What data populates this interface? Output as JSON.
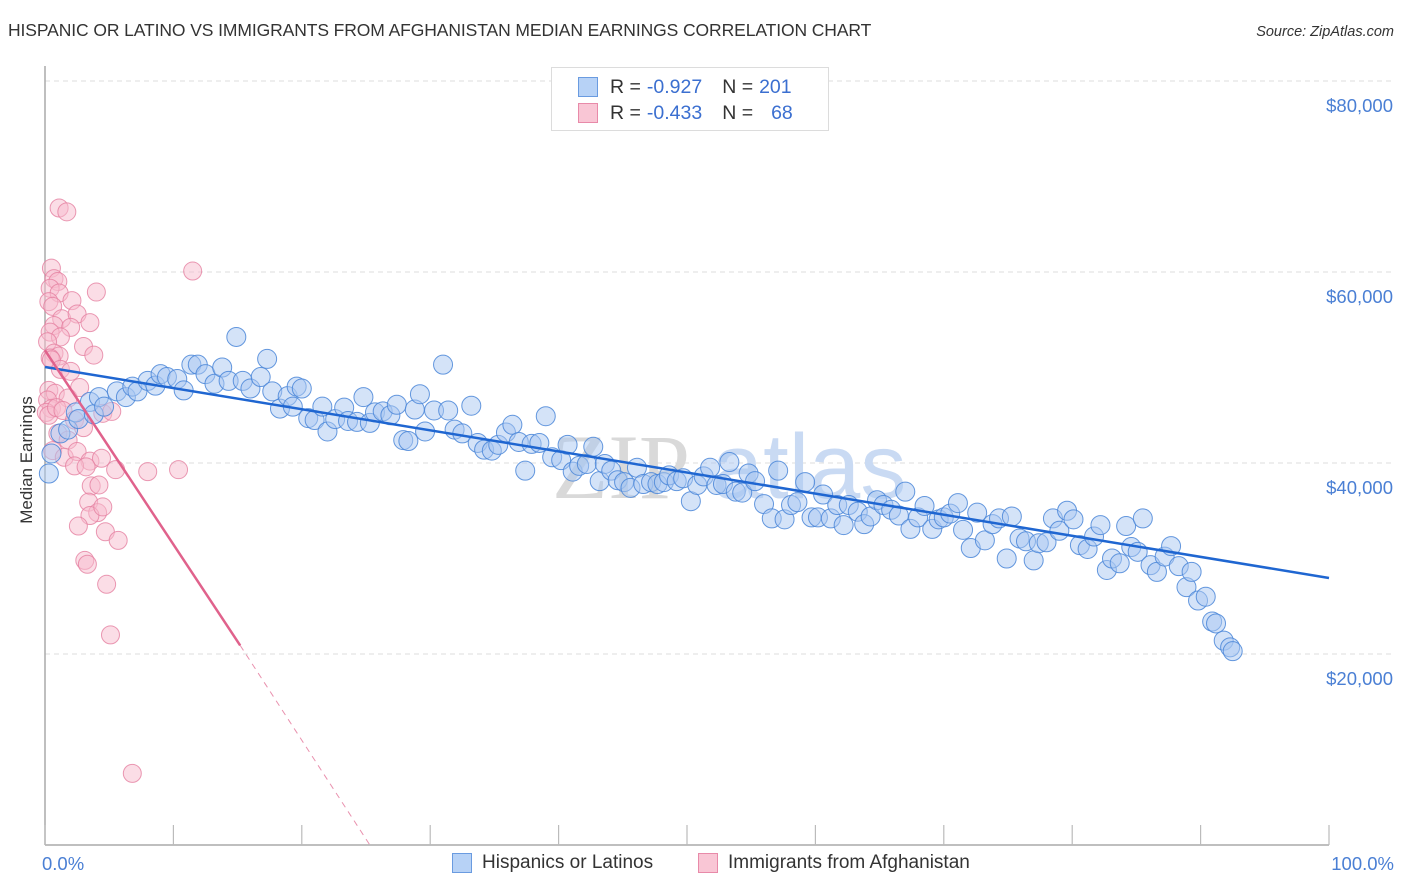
{
  "header": {
    "title": "HISPANIC OR LATINO VS IMMIGRANTS FROM AFGHANISTAN MEDIAN EARNINGS CORRELATION CHART",
    "source": "Source: ZipAtlas.com"
  },
  "colors": {
    "blue_fill": "#a9c8f2",
    "blue_stroke": "#4a86d8",
    "blue_line": "#1f66d1",
    "pink_fill": "#f7bccd",
    "pink_stroke": "#e57fa0",
    "pink_line": "#e0628c",
    "axis_label": "#4a7fd4",
    "grid": "#dddddd"
  },
  "legend": {
    "rows": [
      {
        "r_label": "R =",
        "r_value": "-0.927",
        "n_label": "N =",
        "n_value": "201"
      },
      {
        "r_label": "R =",
        "r_value": "-0.433",
        "n_label": "N =",
        "n_value": "68"
      }
    ]
  },
  "bottom_legend": [
    "Hispanics or Latinos",
    "Immigrants from Afghanistan"
  ],
  "watermark": {
    "part1": "ZIP",
    "part2": "atlas"
  },
  "chart_data": {
    "type": "scatter",
    "title": "HISPANIC OR LATINO VS IMMIGRANTS FROM AFGHANISTAN MEDIAN EARNINGS CORRELATION CHART",
    "xlabel": "",
    "ylabel": "Median Earnings",
    "xlim": [
      0,
      100
    ],
    "ylim": [
      0,
      85000
    ],
    "x_tick_labels": [
      "0.0%",
      "100.0%"
    ],
    "y_ticks": [
      20000,
      40000,
      60000,
      80000
    ],
    "y_tick_labels": [
      "$20,000",
      "$40,000",
      "$60,000",
      "$80,000"
    ],
    "grid": true,
    "legend_position": "top-center",
    "series": [
      {
        "name": "Hispanics or Latinos",
        "R": -0.927,
        "N": 201,
        "trend": {
          "x": [
            0,
            100
          ],
          "y": [
            50050,
            27960
          ]
        },
        "points": [
          [
            0.3,
            38900
          ],
          [
            0.5,
            41000
          ],
          [
            1.2,
            43100
          ],
          [
            1.8,
            43500
          ],
          [
            2.4,
            45300
          ],
          [
            2.6,
            44600
          ],
          [
            3.5,
            46400
          ],
          [
            3.8,
            45100
          ],
          [
            4.2,
            46900
          ],
          [
            4.6,
            45900
          ],
          [
            5.6,
            47500
          ],
          [
            6.3,
            46900
          ],
          [
            6.8,
            48000
          ],
          [
            7.2,
            47500
          ],
          [
            8.0,
            48600
          ],
          [
            8.6,
            48100
          ],
          [
            9.0,
            49300
          ],
          [
            9.5,
            49000
          ],
          [
            10.3,
            48800
          ],
          [
            10.8,
            47600
          ],
          [
            11.4,
            50300
          ],
          [
            11.9,
            50300
          ],
          [
            12.5,
            49300
          ],
          [
            13.2,
            48300
          ],
          [
            13.8,
            50000
          ],
          [
            14.3,
            48600
          ],
          [
            14.9,
            53200
          ],
          [
            15.4,
            48600
          ],
          [
            16.0,
            47800
          ],
          [
            16.8,
            49000
          ],
          [
            17.3,
            50900
          ],
          [
            17.7,
            47500
          ],
          [
            18.3,
            45700
          ],
          [
            18.9,
            47000
          ],
          [
            19.3,
            45900
          ],
          [
            19.6,
            48000
          ],
          [
            20.0,
            47800
          ],
          [
            20.5,
            44700
          ],
          [
            21.0,
            44500
          ],
          [
            21.6,
            45900
          ],
          [
            22.0,
            43300
          ],
          [
            22.6,
            44600
          ],
          [
            23.3,
            45800
          ],
          [
            23.6,
            44400
          ],
          [
            24.3,
            44300
          ],
          [
            24.8,
            46900
          ],
          [
            25.3,
            44200
          ],
          [
            25.7,
            45300
          ],
          [
            26.3,
            45400
          ],
          [
            26.9,
            45000
          ],
          [
            27.4,
            46100
          ],
          [
            27.9,
            42400
          ],
          [
            28.3,
            42300
          ],
          [
            28.8,
            45600
          ],
          [
            29.2,
            47200
          ],
          [
            29.6,
            43300
          ],
          [
            30.3,
            45500
          ],
          [
            31.0,
            50300
          ],
          [
            31.4,
            45500
          ],
          [
            31.9,
            43500
          ],
          [
            32.5,
            43100
          ],
          [
            33.2,
            46000
          ],
          [
            33.7,
            42100
          ],
          [
            34.2,
            41400
          ],
          [
            34.8,
            41300
          ],
          [
            35.3,
            41900
          ],
          [
            35.9,
            43200
          ],
          [
            36.4,
            44000
          ],
          [
            36.9,
            42200
          ],
          [
            37.4,
            39200
          ],
          [
            37.9,
            42000
          ],
          [
            38.5,
            42100
          ],
          [
            39.0,
            44900
          ],
          [
            39.5,
            40600
          ],
          [
            40.2,
            40300
          ],
          [
            40.7,
            41900
          ],
          [
            41.1,
            39100
          ],
          [
            41.6,
            39700
          ],
          [
            42.2,
            39900
          ],
          [
            42.7,
            41700
          ],
          [
            43.2,
            38100
          ],
          [
            43.6,
            39900
          ],
          [
            44.1,
            39200
          ],
          [
            44.6,
            38200
          ],
          [
            45.1,
            38000
          ],
          [
            45.6,
            37400
          ],
          [
            46.1,
            39500
          ],
          [
            46.6,
            37800
          ],
          [
            47.2,
            38000
          ],
          [
            47.7,
            37800
          ],
          [
            48.2,
            38000
          ],
          [
            48.6,
            38700
          ],
          [
            49.2,
            38100
          ],
          [
            49.7,
            38400
          ],
          [
            50.3,
            36000
          ],
          [
            50.8,
            37700
          ],
          [
            51.3,
            38600
          ],
          [
            51.8,
            39500
          ],
          [
            52.3,
            37700
          ],
          [
            52.8,
            37800
          ],
          [
            53.3,
            40100
          ],
          [
            53.8,
            37000
          ],
          [
            54.3,
            36900
          ],
          [
            54.8,
            38900
          ],
          [
            55.3,
            38100
          ],
          [
            56.0,
            35700
          ],
          [
            56.6,
            34200
          ],
          [
            57.1,
            39200
          ],
          [
            57.6,
            34100
          ],
          [
            58.1,
            35600
          ],
          [
            58.6,
            35900
          ],
          [
            59.2,
            38000
          ],
          [
            59.7,
            34300
          ],
          [
            60.2,
            34300
          ],
          [
            60.6,
            36700
          ],
          [
            61.2,
            34200
          ],
          [
            61.7,
            35600
          ],
          [
            62.2,
            33500
          ],
          [
            62.6,
            35600
          ],
          [
            63.3,
            34900
          ],
          [
            63.8,
            33600
          ],
          [
            64.3,
            34400
          ],
          [
            64.8,
            36100
          ],
          [
            65.3,
            35600
          ],
          [
            65.9,
            35100
          ],
          [
            66.5,
            34500
          ],
          [
            67.0,
            37000
          ],
          [
            67.4,
            33100
          ],
          [
            68.0,
            34300
          ],
          [
            68.5,
            35500
          ],
          [
            69.1,
            33100
          ],
          [
            69.6,
            34100
          ],
          [
            70.0,
            34300
          ],
          [
            70.5,
            34700
          ],
          [
            71.1,
            35800
          ],
          [
            71.5,
            33000
          ],
          [
            72.1,
            31100
          ],
          [
            72.6,
            34800
          ],
          [
            73.2,
            31900
          ],
          [
            73.8,
            33600
          ],
          [
            74.3,
            34200
          ],
          [
            74.9,
            30000
          ],
          [
            75.3,
            34400
          ],
          [
            75.9,
            32100
          ],
          [
            76.4,
            31800
          ],
          [
            77.0,
            29800
          ],
          [
            77.4,
            31600
          ],
          [
            78.0,
            31700
          ],
          [
            78.5,
            34200
          ],
          [
            79.0,
            32900
          ],
          [
            79.6,
            35000
          ],
          [
            80.1,
            34100
          ],
          [
            80.6,
            31400
          ],
          [
            81.2,
            31000
          ],
          [
            81.7,
            32300
          ],
          [
            82.2,
            33500
          ],
          [
            82.7,
            28800
          ],
          [
            83.1,
            30000
          ],
          [
            83.7,
            29500
          ],
          [
            84.2,
            33400
          ],
          [
            84.6,
            31200
          ],
          [
            85.1,
            30700
          ],
          [
            85.5,
            34200
          ],
          [
            86.1,
            29300
          ],
          [
            86.6,
            28600
          ],
          [
            87.2,
            30200
          ],
          [
            87.7,
            31300
          ],
          [
            88.3,
            29200
          ],
          [
            88.9,
            27000
          ],
          [
            89.3,
            28600
          ],
          [
            89.8,
            25600
          ],
          [
            90.4,
            26000
          ],
          [
            90.9,
            23400
          ],
          [
            91.2,
            23200
          ],
          [
            91.8,
            21400
          ],
          [
            92.3,
            20700
          ],
          [
            92.5,
            20300
          ]
        ]
      },
      {
        "name": "Immigrants from Afghanistan",
        "R": -0.433,
        "N": 68,
        "trend": {
          "x": [
            0,
            15.2,
            25.3
          ],
          "y": [
            51800,
            20900,
            0
          ],
          "solid_until_x": 15.2
        },
        "points": [
          [
            1.1,
            66700
          ],
          [
            1.7,
            66300
          ],
          [
            0.5,
            60400
          ],
          [
            0.7,
            59300
          ],
          [
            1.0,
            59000
          ],
          [
            0.4,
            58300
          ],
          [
            1.1,
            57800
          ],
          [
            4.0,
            57900
          ],
          [
            11.5,
            60100
          ],
          [
            0.3,
            56900
          ],
          [
            0.6,
            56400
          ],
          [
            2.1,
            57000
          ],
          [
            1.3,
            55100
          ],
          [
            2.5,
            55600
          ],
          [
            0.7,
            54400
          ],
          [
            2.0,
            54200
          ],
          [
            3.5,
            54700
          ],
          [
            0.4,
            53700
          ],
          [
            1.2,
            53200
          ],
          [
            3.0,
            52200
          ],
          [
            0.2,
            52700
          ],
          [
            0.7,
            51500
          ],
          [
            1.1,
            51200
          ],
          [
            0.4,
            51000
          ],
          [
            0.5,
            50800
          ],
          [
            3.8,
            51300
          ],
          [
            1.2,
            49800
          ],
          [
            2.0,
            49600
          ],
          [
            0.3,
            47600
          ],
          [
            0.8,
            47300
          ],
          [
            1.8,
            46800
          ],
          [
            2.7,
            47900
          ],
          [
            0.2,
            46600
          ],
          [
            0.5,
            45700
          ],
          [
            0.1,
            45300
          ],
          [
            0.3,
            45000
          ],
          [
            0.9,
            45800
          ],
          [
            1.4,
            45500
          ],
          [
            2.3,
            44500
          ],
          [
            3.0,
            43700
          ],
          [
            4.5,
            45200
          ],
          [
            5.2,
            45400
          ],
          [
            1.0,
            43100
          ],
          [
            1.8,
            42400
          ],
          [
            0.6,
            41300
          ],
          [
            1.5,
            40600
          ],
          [
            2.5,
            41200
          ],
          [
            3.5,
            40200
          ],
          [
            4.4,
            40500
          ],
          [
            2.3,
            39700
          ],
          [
            3.2,
            39600
          ],
          [
            5.5,
            39300
          ],
          [
            8.0,
            39100
          ],
          [
            10.4,
            39300
          ],
          [
            3.6,
            37600
          ],
          [
            4.2,
            37700
          ],
          [
            3.4,
            35900
          ],
          [
            4.1,
            34800
          ],
          [
            3.5,
            34500
          ],
          [
            4.5,
            35400
          ],
          [
            2.6,
            33400
          ],
          [
            4.7,
            32800
          ],
          [
            5.7,
            31900
          ],
          [
            3.1,
            29800
          ],
          [
            3.3,
            29400
          ],
          [
            4.8,
            27300
          ],
          [
            5.1,
            22000
          ],
          [
            6.8,
            7500
          ]
        ]
      }
    ]
  }
}
